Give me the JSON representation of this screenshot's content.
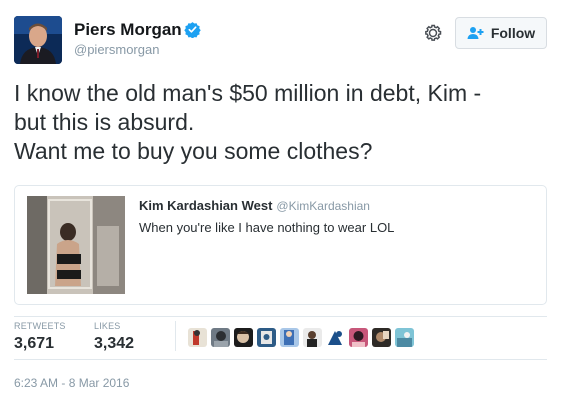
{
  "author": {
    "name": "Piers Morgan",
    "handle": "@piersmorgan",
    "avatar_icon": "profile-photo-icon",
    "verified_icon": "verified-badge-icon"
  },
  "actions": {
    "settings_icon": "gear-icon",
    "follow_label": "Follow",
    "follow_icon": "add-user-icon"
  },
  "tweet": {
    "lines": [
      "I know the old man's $50 million in debt, Kim -",
      "but this is absurd.",
      "Want me to buy you some clothes?"
    ]
  },
  "quoted": {
    "name": "Kim Kardashian West",
    "handle": "@KimKardashian",
    "text": "When you're like I have nothing to wear LOL"
  },
  "stats": {
    "retweets_label": "RETWEETS",
    "retweets": "3,671",
    "likes_label": "LIKES",
    "likes": "3,342"
  },
  "likers_count": 10,
  "timestamp": "6:23 AM - 8 Mar 2016",
  "colors": {
    "verified": "#1da1f2",
    "follow_icon": "#1da1f2",
    "border": "#e1e8ed",
    "meta_text": "#8899a6"
  }
}
